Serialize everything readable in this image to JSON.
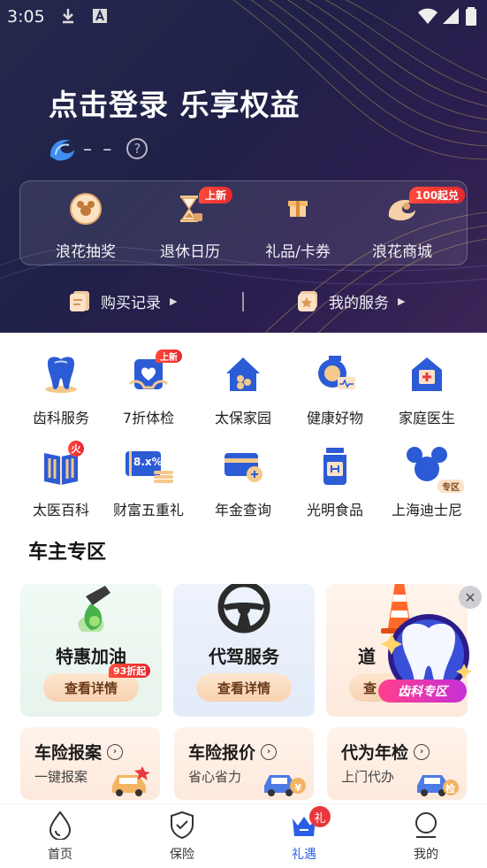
{
  "status_bar": {
    "time": "3:05"
  },
  "hero": {
    "title": "点击登录 乐享权益",
    "user_placeholder": "– –",
    "help_glyph": "?",
    "quick_actions": [
      {
        "label": "浪花抽奖",
        "icon": "mickey-coin-icon"
      },
      {
        "label": "退休日历",
        "icon": "hourglass-icon",
        "badge": "上新"
      },
      {
        "label": "礼品/卡券",
        "icon": "gift-box-icon"
      },
      {
        "label": "浪花商城",
        "icon": "wave-shop-icon",
        "badge": "100起兑"
      }
    ],
    "links": [
      {
        "label": "购买记录",
        "icon": "order-record-icon"
      },
      {
        "label": "我的服务",
        "icon": "my-service-icon"
      }
    ]
  },
  "services": [
    {
      "label": "齿科服务",
      "icon": "tooth-icon"
    },
    {
      "label": "7折体检",
      "icon": "health-check-icon",
      "badge": "上新"
    },
    {
      "label": "太保家园",
      "icon": "home-icon"
    },
    {
      "label": "健康好物",
      "icon": "health-goods-icon"
    },
    {
      "label": "家庭医生",
      "icon": "family-doctor-icon"
    },
    {
      "label": "太医百科",
      "icon": "encyclopedia-icon",
      "badge": "火"
    },
    {
      "label": "财富五重礼",
      "icon": "wealth-card-icon",
      "card_text": "8.x%"
    },
    {
      "label": "年金查询",
      "icon": "annuity-card-icon"
    },
    {
      "label": "光明食品",
      "icon": "food-jar-icon"
    },
    {
      "label": "上海迪士尼",
      "icon": "disney-icon",
      "badge": "专区"
    }
  ],
  "owner_section": {
    "title": "车主专区",
    "cards": [
      {
        "title": "特惠加油",
        "button": "查看详情",
        "badge": "93折起",
        "icon": "fuel-pump-icon"
      },
      {
        "title": "代驾服务",
        "button": "查看详情",
        "icon": "steering-wheel-icon"
      },
      {
        "title": "道",
        "button": "查",
        "icon": "traffic-cone-icon"
      }
    ],
    "promo": {
      "label": "齿科专区",
      "close_glyph": "✕"
    },
    "insurance_cards": [
      {
        "title": "车险报案",
        "sub": "一键报案"
      },
      {
        "title": "车险报价",
        "sub": "省心省力",
        "ill_text": "¥"
      },
      {
        "title": "代为年检",
        "sub": "上门代办",
        "ill_text": "检"
      }
    ]
  },
  "bottom_nav": {
    "items": [
      {
        "label": "首页",
        "icon": "water-drop-icon"
      },
      {
        "label": "保险",
        "icon": "shield-check-icon"
      },
      {
        "label": "礼遇",
        "icon": "crown-icon",
        "badge": "礼",
        "active": true
      },
      {
        "label": "我的",
        "icon": "person-icon"
      }
    ]
  },
  "colors": {
    "hero_bg": "#25284d",
    "accent_blue": "#2a5ee8",
    "badge_red": "#e6282f",
    "button_peach": "#f7d2b0"
  }
}
